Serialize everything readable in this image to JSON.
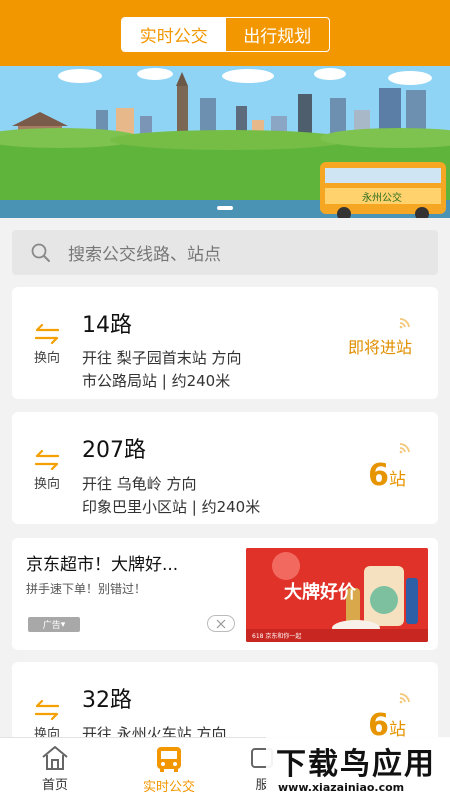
{
  "header": {
    "tabs": [
      {
        "label": "实时公交",
        "active": true
      },
      {
        "label": "出行规划",
        "active": false
      }
    ],
    "accent": "#f39700"
  },
  "banner": {
    "bus_text": "永州公交"
  },
  "search": {
    "placeholder": "搜索公交线路、站点",
    "icon": "search-icon"
  },
  "routes": [
    {
      "name": "14路",
      "direction": "开往 梨子园首末站 方向",
      "stop_info": "市公路局站 | 约240米",
      "swap_label": "换向",
      "status": "即将进站"
    },
    {
      "name": "207路",
      "direction": "开往 乌龟岭 方向",
      "stop_info": "印象巴里小区站 | 约240米",
      "swap_label": "换向",
      "stops": "6",
      "stops_unit": "站"
    },
    {
      "name": "32路",
      "direction": "开往 永州火车站 方向",
      "swap_label": "换向",
      "stops": "6",
      "stops_unit": "站"
    }
  ],
  "ad": {
    "title": "京东超市！大牌好...",
    "subtitle": "拼手速下单！别错过！",
    "badge": "广告",
    "image_title": "大牌好价",
    "image_footer": "618 京东和你一起"
  },
  "nav": {
    "items": [
      {
        "label": "首页",
        "icon": "home-icon",
        "active": false
      },
      {
        "label": "实时公交",
        "icon": "bus-icon",
        "active": true
      },
      {
        "label": "服",
        "icon": "service-icon",
        "active": false
      }
    ]
  },
  "watermark": {
    "title": "下载鸟应用",
    "url": "www.xiazainiao.com"
  }
}
